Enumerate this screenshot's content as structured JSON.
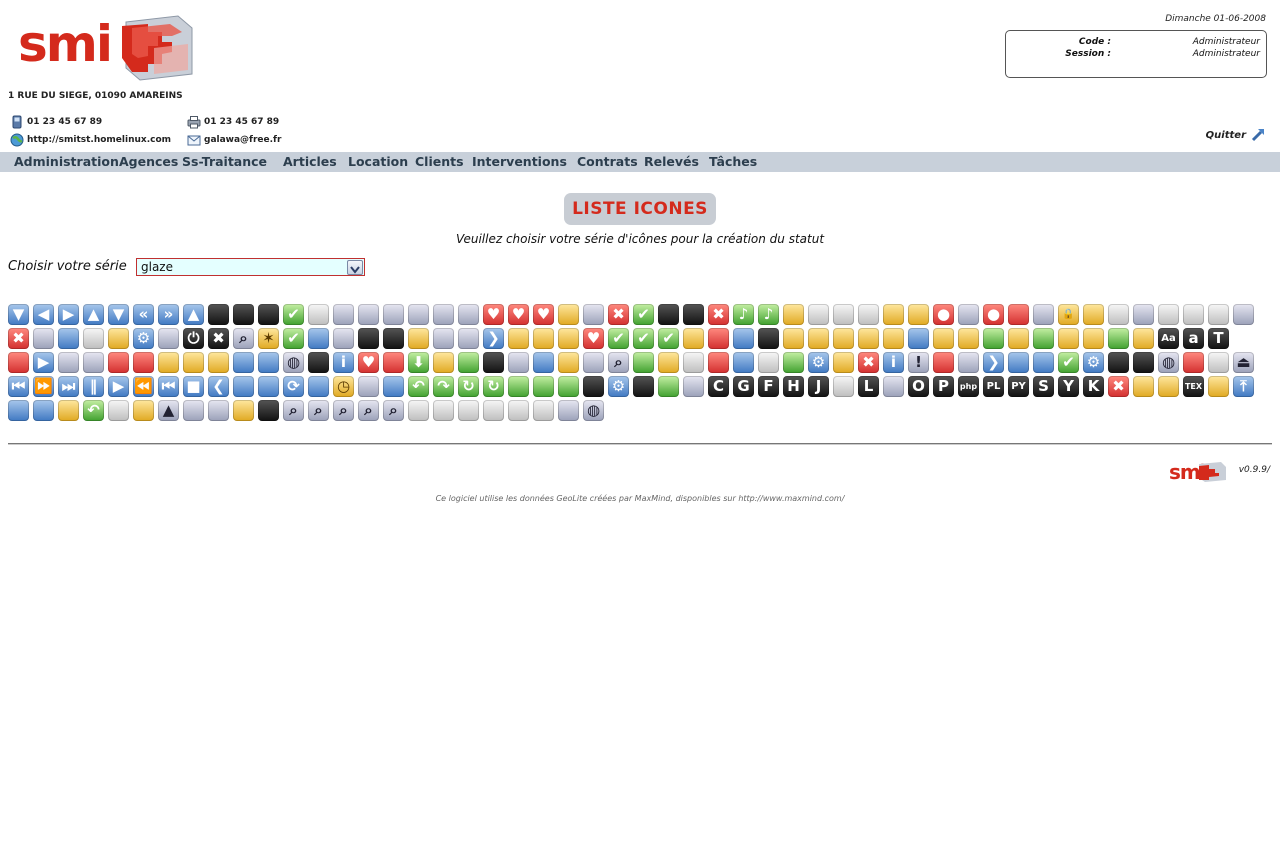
{
  "header": {
    "logo_text": "smi",
    "address": "1 RUE DU SIEGE, 01090 AMAREINS",
    "phone": "01 23 45 67 89",
    "fax": "01 23 45 67 89",
    "website": "http://smitst.homelinux.com",
    "email": "galawa@free.fr",
    "date": "Dimanche 01-06-2008",
    "code_label": "Code :",
    "code_value": "Administrateur",
    "session_label": "Session :",
    "session_value": "Administrateur",
    "quit_label": "Quitter"
  },
  "menu": {
    "items": [
      "Administration",
      "Agences",
      "Ss-Traitance",
      "Articles",
      "Location",
      "Clients",
      "Interventions",
      "Contrats",
      "Relevés",
      "Tâches"
    ]
  },
  "main": {
    "title": "LISTE ICONES",
    "subtitle": "Veuillez choisir votre série d'icônes pour la création du statut",
    "choose_label": "Choisir votre série",
    "series_value": "glaze"
  },
  "icons": {
    "rows": [
      [
        "blue-down",
        "blue-left",
        "blue-right",
        "blue-up",
        "blue-down-2",
        "blue-rewind",
        "blue-ffwd",
        "blue-up-2",
        "floppy",
        "floppy-2",
        "floppy-3",
        "check",
        "doc-text",
        "grid",
        "image",
        "paperclip",
        "back",
        "binary",
        "cubes",
        "heart",
        "heart-down",
        "heart-up",
        "tag",
        "download",
        "red-x",
        "green-check",
        "camera",
        "camera-2",
        "red-x-2",
        "music",
        "music-2",
        "cd-gold",
        "cd",
        "cd-2",
        "cd-3",
        "cd-gold-2",
        "cd-gold-3",
        "bomb",
        "color",
        "bomb-2",
        "house",
        "spiral",
        "lock",
        "lock-2",
        "doc-lines",
        "funnel",
        "dvd",
        "dvd-2",
        "copy",
        "scissors"
      ],
      [
        "red-x-3",
        "clipboard",
        "trash",
        "blank",
        "key",
        "gear",
        "paint",
        "power",
        "black-x",
        "search",
        "star",
        "check-2",
        "drive",
        "edit",
        "save",
        "save-2",
        "lock-3",
        "refresh",
        "tools",
        "next",
        "tag-2",
        "tag-3",
        "tag-4",
        "heart-tag",
        "check-3",
        "check-4",
        "check-5",
        "tag-5",
        "house-2",
        "network",
        "camera-3",
        "lock-4",
        "tag-6",
        "star-2",
        "tag-7",
        "tag-8",
        "network-2",
        "tag-9",
        "tag-10",
        "music-3",
        "box",
        "check-6",
        "tag-11",
        "tag-12",
        "check-7",
        "tag-13",
        "font",
        "font-2",
        "font-3"
      ],
      [
        "mail",
        "play",
        "select",
        "id",
        "mail-2",
        "house-3",
        "lock-5",
        "lock-6",
        "lock-7",
        "drive-2",
        "drive-3",
        "globe",
        "camera-4",
        "info",
        "heart-2",
        "house-4",
        "down-arrow",
        "lock-8",
        "golf",
        "screen",
        "antenna",
        "laptop",
        "lock-9",
        "chart",
        "search-2",
        "down-2",
        "star-3",
        "list",
        "mail-3",
        "reply",
        "list-2",
        "up-2",
        "gear-2",
        "box-2",
        "red-x-4",
        "info-2",
        "warning",
        "mail-4",
        "monitor",
        "chevron",
        "network-3",
        "network-4",
        "check-8",
        "gear-3",
        "joystick",
        "clapper",
        "globe-2",
        "pdf",
        "window",
        "eject"
      ],
      [
        "skip-back",
        "ffwd-2",
        "skip",
        "pause",
        "play-2",
        "rewind",
        "skip-start",
        "stop",
        "chevron-left",
        "drive-4",
        "drive-5",
        "sync",
        "drive-6",
        "clock",
        "help",
        "info-3",
        "undo",
        "redo",
        "reload",
        "reload-2",
        "arrow-1",
        "arrow-2",
        "arrow-3",
        "rpm",
        "gear-4",
        "terminal",
        "music-4",
        "dots",
        "C",
        "G",
        "F",
        "H",
        "J",
        "doc",
        "L",
        "flower",
        "O",
        "P",
        "php",
        "PL",
        "PY",
        "S",
        "Y",
        "K",
        "red-x-5",
        "pen",
        "package",
        "TeX",
        "package-2",
        "top"
      ],
      [
        "trash-2",
        "trash-3",
        "pencil",
        "undo-2",
        "page",
        "lock-10",
        "cone",
        "usb",
        "usb-2",
        "pen-2",
        "clapper-2",
        "zoom-in",
        "zoom-out",
        "zoom",
        "zoom-2",
        "zoom-3",
        "form",
        "form-2",
        "form-3",
        "list-3",
        "form-4",
        "window-2",
        "chart-2",
        "globe-3"
      ]
    ]
  },
  "footer": {
    "logo_text": "smi",
    "version": "v0.9.9/",
    "credit": "Ce logiciel utilise les données GeoLite créées par MaxMind, disponibles sur http://www.maxmind.com/"
  }
}
